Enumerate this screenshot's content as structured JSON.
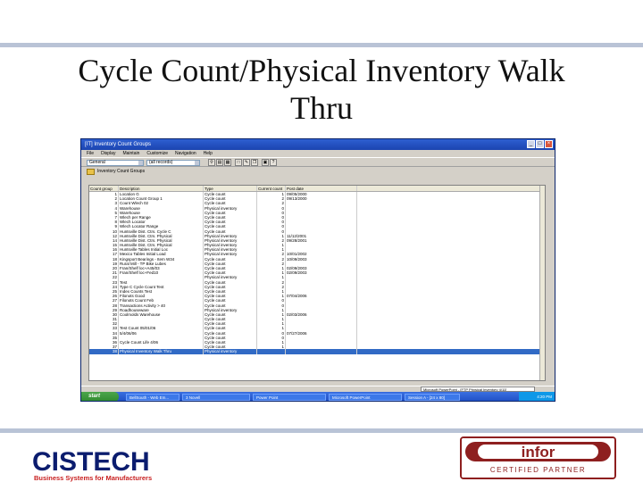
{
  "slide": {
    "title_line1": "Cycle Count/Physical Inventory Walk",
    "title_line2": "Thru"
  },
  "window": {
    "title": "[IT] Inventory Count Groups",
    "menu": [
      "File",
      "Display",
      "Maintain",
      "Customize",
      "Navigation",
      "Help"
    ],
    "view_select": "General",
    "filter_select": "(all records)",
    "subtoolbar_label": "Inventory Count Groups",
    "columns": [
      "Count group",
      "Description",
      "Type",
      "Current count",
      "Post date"
    ],
    "rows": [
      [
        "1",
        "Location G",
        "Cycle count",
        "1",
        "09/05/2000"
      ],
      [
        "2",
        "Location Count Group 1",
        "Cycle count",
        "2",
        "09/13/2000"
      ],
      [
        "3",
        "Count Wlech 02",
        "Cycle count",
        "2",
        ""
      ],
      [
        "4",
        "Warehouse",
        "Physical inventory",
        "0",
        ""
      ],
      [
        "5",
        "Warehouse",
        "Cycle count",
        "0",
        ""
      ],
      [
        "7",
        "Wlech per Range",
        "Cycle count",
        "0",
        ""
      ],
      [
        "8",
        "Wlech Locator",
        "Cycle count",
        "0",
        ""
      ],
      [
        "9",
        "Wlech Locator Range",
        "Cycle count",
        "0",
        ""
      ],
      [
        "10",
        "Huntsville Dist. Ctrs. Cycle C",
        "Cycle count",
        "0",
        ""
      ],
      [
        "12",
        "Huntsville Dist. Ctrs. Physical",
        "Physical inventory",
        "1",
        "11/12/2001"
      ],
      [
        "14",
        "Huntsville Dist. Ctrs. Physical",
        "Physical inventory",
        "2",
        "09/28/2001"
      ],
      [
        "15",
        "Huntsville Dist. Ctrs. Physical",
        "Physical inventory",
        "1",
        ""
      ],
      [
        "16",
        "Huntsville Tables Initial Loc",
        "Physical inventory",
        "1",
        ""
      ],
      [
        "17",
        "Mexico Tables Initial Load",
        "Physical inventory",
        "2",
        "10/01/2002"
      ],
      [
        "18",
        "Kingsport Bearings - Item W34",
        "Cycle count",
        "2",
        "10/09/2003"
      ],
      [
        "19",
        "Rural Mill - TP Bike Lubes",
        "Cycle count",
        "2",
        ""
      ],
      [
        "20",
        "Fran/Shelf loc+A45/03",
        "Cycle count",
        "1",
        "02/09/2003"
      ],
      [
        "21",
        "Fran/Shelf loc+Fed10",
        "Cycle count",
        "1",
        "02/09/2003"
      ],
      [
        "22",
        "",
        "Physical inventory",
        "1",
        ""
      ],
      [
        "23",
        "Test",
        "Cycle count",
        "2",
        ""
      ],
      [
        "24",
        "Type C Cycle Count Test",
        "Cycle count",
        "2",
        ""
      ],
      [
        "25",
        "Index Counts Test",
        "Cycle count",
        "1",
        ""
      ],
      [
        "26",
        "Filonots Good",
        "Cycle count",
        "1",
        "07/04/2006"
      ],
      [
        "27",
        "Filonots Count Feb",
        "Cycle count",
        "0",
        ""
      ],
      [
        "28",
        "Transactions Activity > 40",
        "Cycle count",
        "0",
        ""
      ],
      [
        "29",
        "Roadhouseware",
        "Physical inventory",
        "1",
        ""
      ],
      [
        "30",
        "Coolmolds Warehouse",
        "Cycle count",
        "1",
        "02/03/2006"
      ],
      [
        "31",
        "",
        "Cycle count",
        "1",
        ""
      ],
      [
        "32",
        "",
        "Cycle count",
        "1",
        ""
      ],
      [
        "33",
        "Test Count 05/01/06",
        "Cycle count",
        "1",
        ""
      ],
      [
        "34",
        "5/4/06/06",
        "Cycle count",
        "0",
        "07/27/2006"
      ],
      [
        "35",
        "",
        "Cycle count",
        "0",
        ""
      ],
      [
        "36",
        "Cycle Count Life 4/06",
        "Cycle count",
        "1",
        ""
      ],
      [
        "37",
        "",
        "Cycle count",
        "1",
        ""
      ],
      [
        "38",
        "Physical Inventory Walk Thru",
        "Physical inventory",
        "",
        ""
      ]
    ],
    "status_message": "Microsoft PowerPoint - [FTP Physical Inventory 4/11]",
    "taskbar": {
      "start": "start",
      "tasks": [
        "BellSouth - Web Em...",
        "3 Novell",
        "Power Point",
        "Microsoft PowerPoint",
        "Session A - [24 x 80]"
      ],
      "clock": "4:20 PM"
    }
  },
  "logos": {
    "cistech_word": "CISTECH",
    "cistech_tagline": "Business Systems for Manufacturers",
    "infor_word": "infor",
    "infor_tagline": "CERTIFIED PARTNER"
  },
  "colors": {
    "rule": "#b9c3d6",
    "cistech_blue": "#0b1c6e",
    "cistech_red": "#c81e1e",
    "infor_red": "#8e1f1f",
    "selection": "#316ac5"
  }
}
